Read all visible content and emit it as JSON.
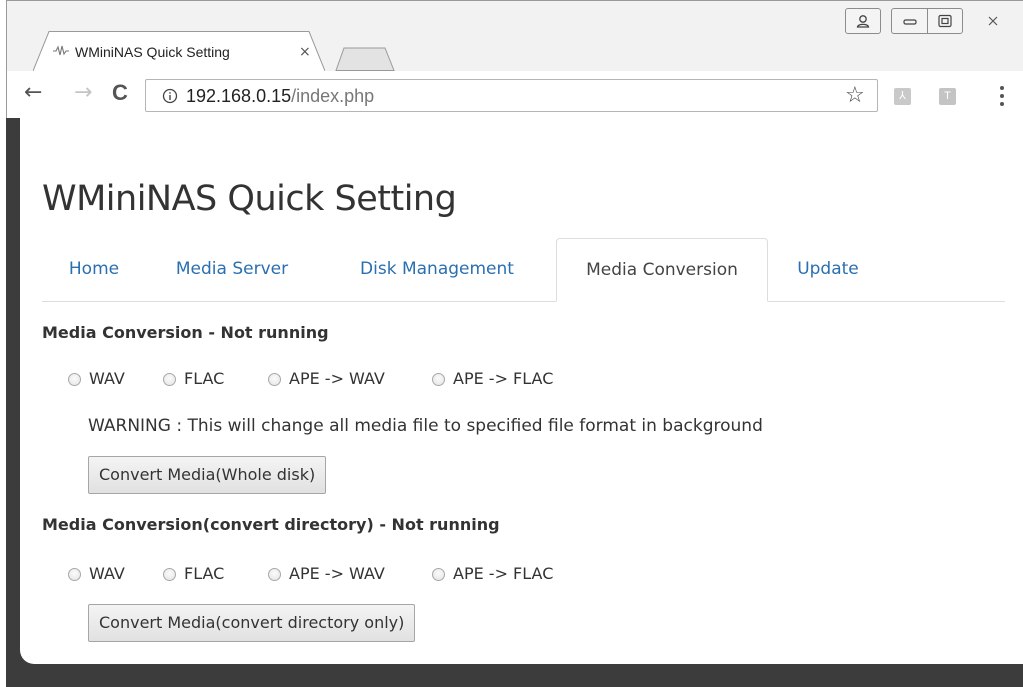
{
  "browser": {
    "tab_title": "WMiniNAS Quick Setting",
    "tab_close": "×",
    "url_host": "192.168.0.15",
    "url_path": "/index.php",
    "ext_pdf_label": "⅄",
    "ext_t_label": "T",
    "star_glyph": "☆",
    "back_glyph": "←",
    "forward_glyph": "→",
    "reload_glyph": "C"
  },
  "page": {
    "title": "WMiniNAS Quick Setting",
    "tabs": [
      {
        "label": "Home",
        "active": false
      },
      {
        "label": "Media Server",
        "active": false
      },
      {
        "label": "Disk Management",
        "active": false
      },
      {
        "label": "Media Conversion",
        "active": true
      },
      {
        "label": "Update",
        "active": false
      }
    ],
    "section1": {
      "heading": "Media Conversion - Not running",
      "options": [
        "WAV",
        "FLAC",
        "APE -> WAV",
        "APE -> FLAC"
      ],
      "warning": "WARNING : This will change all media file to specified file format in background",
      "button": "Convert Media(Whole disk)"
    },
    "section2": {
      "heading": "Media Conversion(convert directory) - Not running",
      "options": [
        "WAV",
        "FLAC",
        "APE -> WAV",
        "APE -> FLAC"
      ],
      "button": "Convert Media(convert directory only)"
    }
  }
}
